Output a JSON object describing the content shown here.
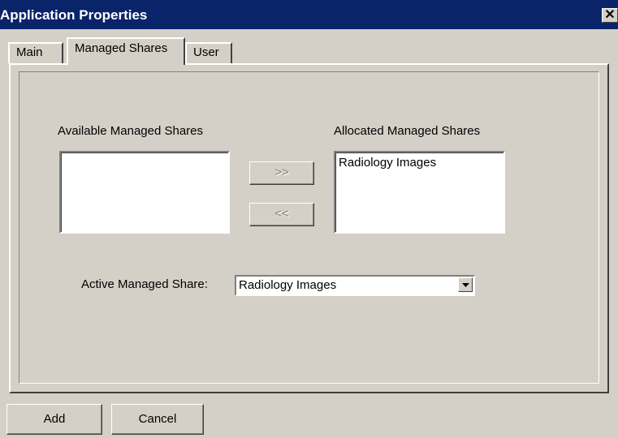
{
  "window": {
    "title": "Application Properties",
    "close_glyph": "✕"
  },
  "tabs": [
    {
      "label": "Main"
    },
    {
      "label": "Managed Shares",
      "selected": true
    },
    {
      "label": "User"
    }
  ],
  "managed_shares": {
    "available_label": "Available Managed Shares",
    "available_items": [],
    "allocated_label": "Allocated Managed Shares",
    "allocated_items": [
      "Radiology Images"
    ],
    "move_right_label": ">>",
    "move_left_label": "<<",
    "active_label": "Active Managed Share:",
    "active_value": "Radiology Images"
  },
  "footer": {
    "add_label": "Add",
    "cancel_label": "Cancel"
  },
  "icons": {
    "close": "close-icon",
    "dropdown": "chevron-down-icon"
  }
}
